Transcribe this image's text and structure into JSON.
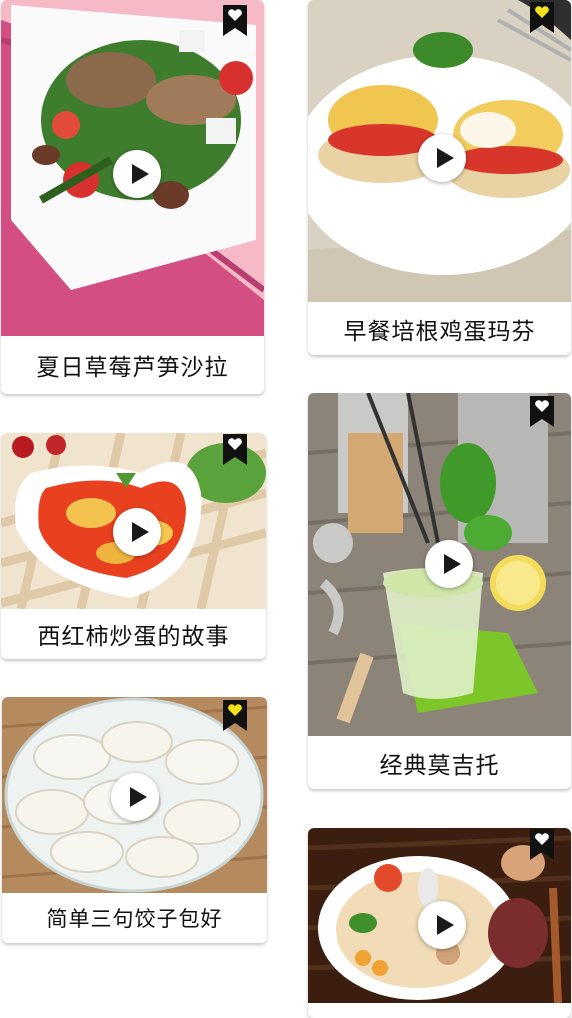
{
  "cards": [
    {
      "title": "夏日草莓芦笋沙拉",
      "heart": "white",
      "icon": "heart-bookmark-icon"
    },
    {
      "title": "早餐培根鸡蛋玛芬",
      "heart": "yellow",
      "icon": "heart-bookmark-icon"
    },
    {
      "title": "西红柿炒蛋的故事",
      "heart": "white",
      "icon": "heart-bookmark-icon"
    },
    {
      "title": "经典莫吉托",
      "heart": "white",
      "icon": "heart-bookmark-icon"
    },
    {
      "title": "简单三句饺子包好",
      "heart": "yellow",
      "icon": "heart-bookmark-icon"
    },
    {
      "title": "",
      "heart": "white",
      "icon": "heart-bookmark-icon"
    }
  ],
  "colors": {
    "heart_white": "#ffffff",
    "heart_yellow": "#f5e21b",
    "bookmark": "#111111"
  }
}
